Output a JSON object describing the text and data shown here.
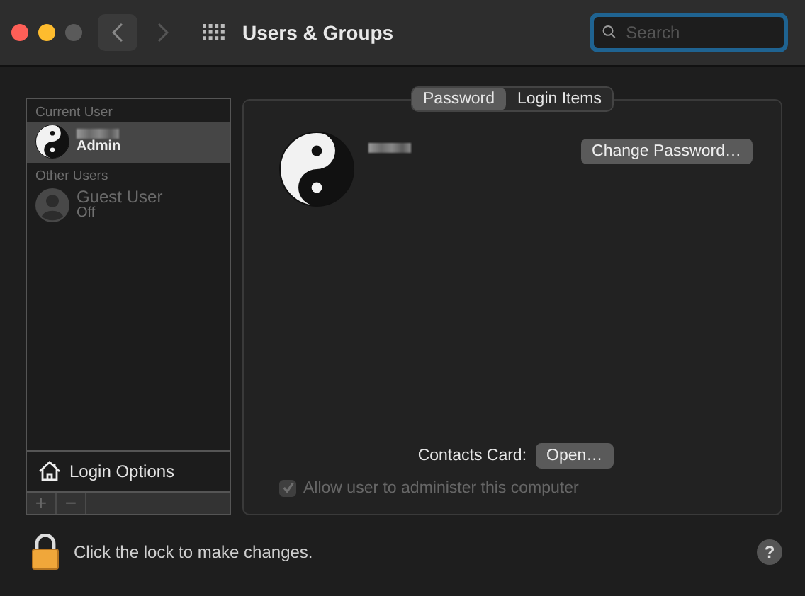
{
  "window": {
    "title": "Users & Groups"
  },
  "search": {
    "placeholder": "Search",
    "focused": true
  },
  "sidebar": {
    "sections": [
      {
        "heading": "Current User",
        "users": [
          {
            "role": "Admin",
            "kind": "yinyang",
            "selected": true,
            "disabled": false
          }
        ]
      },
      {
        "heading": "Other Users",
        "users": [
          {
            "name": "Guest User",
            "role": "Off",
            "kind": "silhouette",
            "selected": false,
            "disabled": true
          }
        ]
      }
    ],
    "login_options": "Login Options",
    "buttons": [
      "+",
      "−"
    ]
  },
  "tabs": [
    {
      "label": "Password",
      "selected": true
    },
    {
      "label": "Login Items",
      "selected": false
    }
  ],
  "change_password": "Change Password…",
  "contacts": {
    "label": "Contacts Card:",
    "button": "Open…"
  },
  "admin_checkbox": {
    "label": "Allow user to administer this computer",
    "checked": true,
    "disabled": true
  },
  "lock_text": "Click the lock to make changes.",
  "help": "?"
}
